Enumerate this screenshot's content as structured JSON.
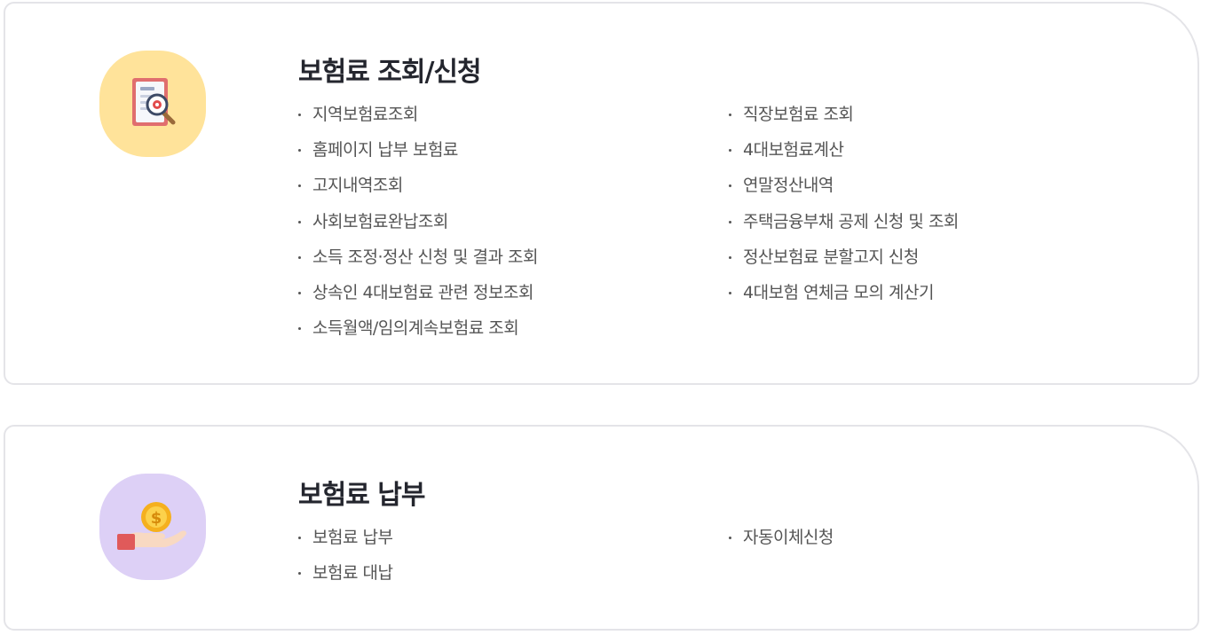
{
  "sections": [
    {
      "title": "보험료 조회/신청",
      "icon": "document-search-icon",
      "icon_bg": "#ffe39a",
      "left_links": [
        "지역보험료조회",
        "홈페이지 납부 보험료",
        "고지내역조회",
        "사회보험료완납조회",
        "소득 조정·정산 신청 및 결과 조회",
        "상속인 4대보험료 관련 정보조회",
        "소득월액/임의계속보험료 조회"
      ],
      "right_links": [
        "직장보험료 조회",
        "4대보험료계산",
        "연말정산내역",
        "주택금융부채 공제 신청 및 조회",
        "정산보험료 분할고지 신청",
        "4대보험 연체금 모의 계산기"
      ]
    },
    {
      "title": "보험료 납부",
      "icon": "coin-hand-icon",
      "icon_bg": "#ddd0f6",
      "left_links": [
        "보험료 납부",
        "보험료 대납"
      ],
      "right_links": [
        "자동이체신청"
      ]
    }
  ]
}
